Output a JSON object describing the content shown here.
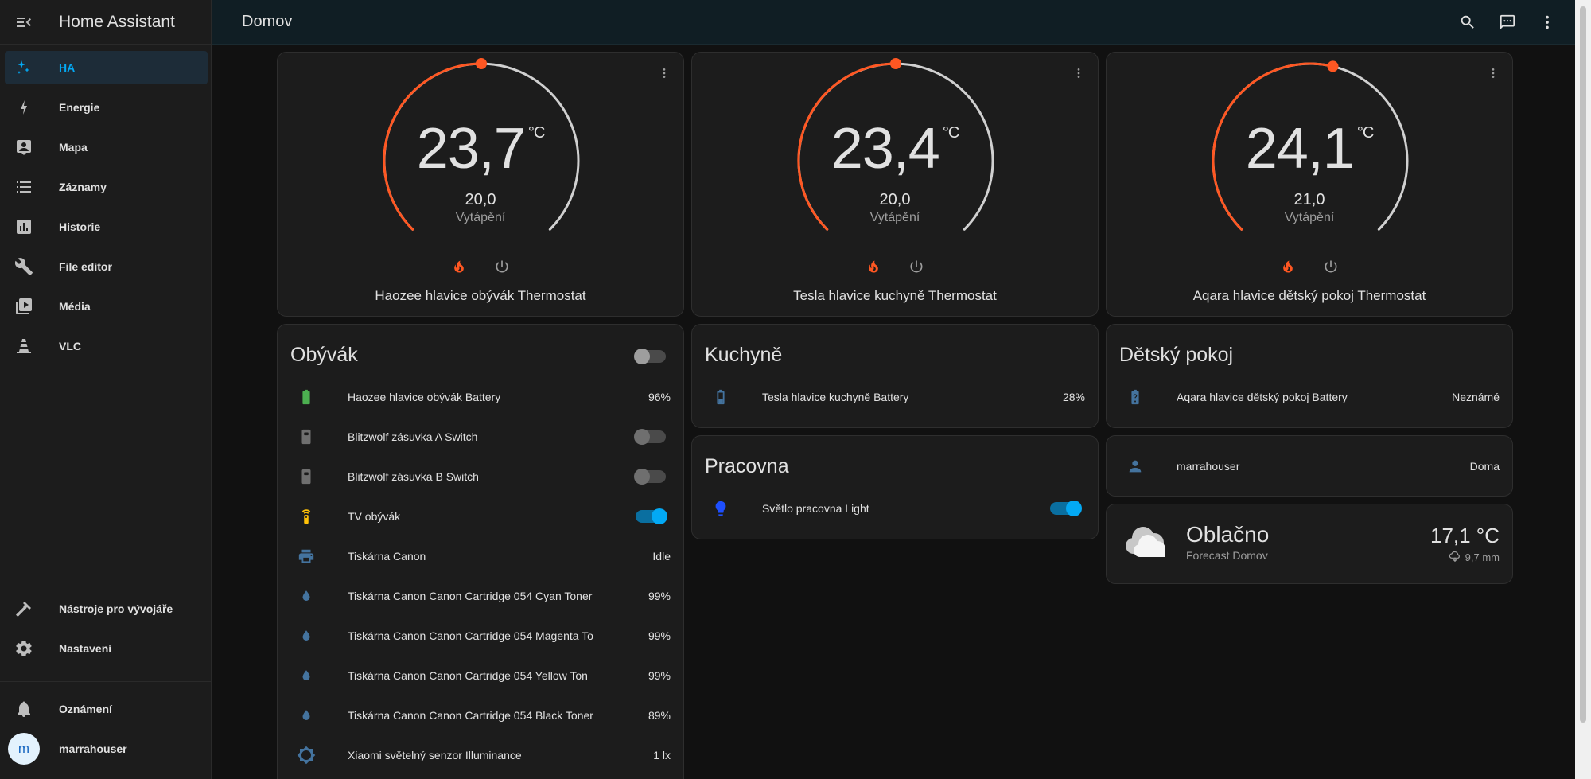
{
  "app": {
    "title": "Home Assistant"
  },
  "sidebar": {
    "items": [
      {
        "label": "HA",
        "icon": "ha-icon"
      },
      {
        "label": "Energie",
        "icon": "lightning-icon"
      },
      {
        "label": "Mapa",
        "icon": "map-icon"
      },
      {
        "label": "Záznamy",
        "icon": "list-icon"
      },
      {
        "label": "Historie",
        "icon": "chart-icon"
      },
      {
        "label": "File editor",
        "icon": "wrench-icon"
      },
      {
        "label": "Média",
        "icon": "media-icon"
      },
      {
        "label": "VLC",
        "icon": "cone-icon"
      }
    ],
    "bottom": [
      {
        "label": "Nástroje pro vývojáře",
        "icon": "hammer-icon"
      },
      {
        "label": "Nastavení",
        "icon": "gear-icon"
      }
    ],
    "notifications_label": "Oznámení",
    "user": {
      "label": "marrahouser",
      "initial": "m"
    }
  },
  "topbar": {
    "title": "Domov"
  },
  "thermostats": [
    {
      "current": "23,7",
      "unit": "°C",
      "target": "20,0",
      "mode": "Vytápění",
      "name": "Haozee hlavice obývák Thermostat"
    },
    {
      "current": "23,4",
      "unit": "°C",
      "target": "20,0",
      "mode": "Vytápění",
      "name": "Tesla hlavice kuchyně Thermostat"
    },
    {
      "current": "24,1",
      "unit": "°C",
      "target": "21,0",
      "mode": "Vytápění",
      "name": "Aqara hlavice dětský pokoj Thermostat"
    }
  ],
  "obyvak": {
    "title": "Obývák",
    "rows": [
      {
        "name": "Haozee hlavice obývák Battery",
        "state": "96%"
      },
      {
        "name": "Blitzwolf zásuvka A Switch",
        "state": ""
      },
      {
        "name": "Blitzwolf zásuvka B Switch",
        "state": ""
      },
      {
        "name": "TV obývák",
        "state": ""
      },
      {
        "name": "Tiskárna Canon",
        "state": "Idle"
      },
      {
        "name": "Tiskárna Canon Canon Cartridge 054 Cyan Toner",
        "state": "99%"
      },
      {
        "name": "Tiskárna Canon Canon Cartridge 054 Magenta To",
        "state": "99%"
      },
      {
        "name": "Tiskárna Canon Canon Cartridge 054 Yellow Ton",
        "state": "99%"
      },
      {
        "name": "Tiskárna Canon Canon Cartridge 054 Black Toner",
        "state": "89%"
      },
      {
        "name": "Xiaomi světelný senzor Illuminance",
        "state": "1 lx"
      }
    ]
  },
  "kuchyne": {
    "title": "Kuchyně",
    "rows": [
      {
        "name": "Tesla hlavice kuchyně Battery",
        "state": "28%"
      }
    ]
  },
  "pracovna": {
    "title": "Pracovna",
    "rows": [
      {
        "name": "Světlo pracovna Light",
        "state": ""
      }
    ]
  },
  "detsky": {
    "title": "Dětský pokoj",
    "rows": [
      {
        "name": "Aqara hlavice dětský pokoj Battery",
        "state": "Neznámé"
      }
    ]
  },
  "person": {
    "name": "marrahouser",
    "state": "Doma"
  },
  "weather": {
    "condition": "Oblačno",
    "subtitle": "Forecast Domov",
    "temperature": "17,1 °C",
    "precipitation": "9,7 mm"
  },
  "colors": {
    "accent": "#03a9f4",
    "heat": "#ff5722",
    "battery_ok": "#4caf50"
  }
}
